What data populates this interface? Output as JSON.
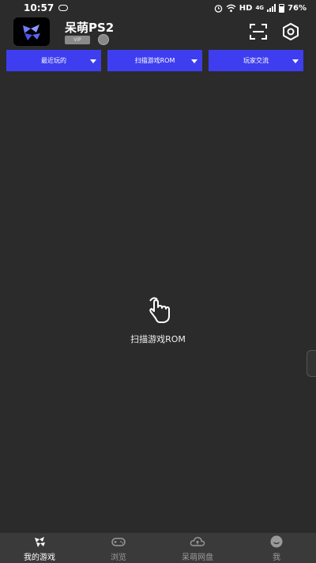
{
  "status_bar": {
    "time": "10:57",
    "network": "HD",
    "network_gen": "4G",
    "battery": "76%"
  },
  "header": {
    "app_name": "呆萌PS2",
    "vip_label": "VIP"
  },
  "tabs": [
    {
      "label": "最近玩的"
    },
    {
      "label": "扫描游戏ROM"
    },
    {
      "label": "玩家交流"
    }
  ],
  "empty_state": {
    "text": "扫描游戏ROM"
  },
  "bottom_nav": [
    {
      "label": "我的游戏",
      "icon": "ps-logo-icon",
      "active": true
    },
    {
      "label": "浏览",
      "icon": "gamepad-icon",
      "active": false
    },
    {
      "label": "呆萌网盘",
      "icon": "cloud-icon",
      "active": false
    },
    {
      "label": "我",
      "icon": "smiley-icon",
      "active": false
    }
  ],
  "colors": {
    "background": "#2b2b2b",
    "tab_accent": "#3e3ef0",
    "nav_bg": "#3a3a3a",
    "nav_inactive": "#9a9a9a"
  }
}
